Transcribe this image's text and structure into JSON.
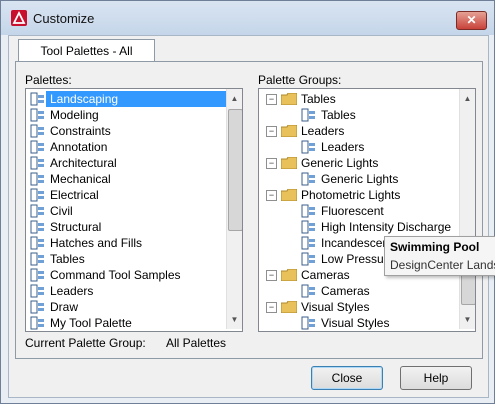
{
  "window": {
    "title": "Customize",
    "close_glyph": "✕",
    "app_icon": "autocad-logo-icon"
  },
  "tab": {
    "label": "Tool Palettes - All Palettes"
  },
  "palettes": {
    "label": "Palettes:",
    "selected_index": 0,
    "items": [
      "Landscaping",
      "Modeling",
      "Constraints",
      "Annotation",
      "Architectural",
      "Mechanical",
      "Electrical",
      "Civil",
      "Structural",
      "Hatches and Fills",
      "Tables",
      "Command Tool Samples",
      "Leaders",
      "Draw",
      "My Tool Palette"
    ]
  },
  "palette_groups": {
    "label": "Palette Groups:",
    "tree": [
      {
        "label": "Tables",
        "level": 0,
        "type": "group"
      },
      {
        "label": "Tables",
        "level": 1,
        "type": "palette"
      },
      {
        "label": "Leaders",
        "level": 0,
        "type": "group"
      },
      {
        "label": "Leaders",
        "level": 1,
        "type": "palette"
      },
      {
        "label": "Generic Lights",
        "level": 0,
        "type": "group"
      },
      {
        "label": "Generic Lights",
        "level": 1,
        "type": "palette"
      },
      {
        "label": "Photometric Lights",
        "level": 0,
        "type": "group"
      },
      {
        "label": "Fluorescent",
        "level": 1,
        "type": "palette"
      },
      {
        "label": "High Intensity Discharge",
        "level": 1,
        "type": "palette"
      },
      {
        "label": "Incandescent",
        "level": 1,
        "type": "palette"
      },
      {
        "label": "Low Pressure Sodium",
        "level": 1,
        "type": "palette"
      },
      {
        "label": "Cameras",
        "level": 0,
        "type": "group"
      },
      {
        "label": "Cameras",
        "level": 1,
        "type": "palette"
      },
      {
        "label": "Visual Styles",
        "level": 0,
        "type": "group"
      },
      {
        "label": "Visual Styles",
        "level": 1,
        "type": "palette"
      }
    ]
  },
  "current_group": {
    "label": "Current Palette Group:",
    "value": "All Palettes"
  },
  "tooltip": {
    "title": "Swimming Pool",
    "subtitle": "DesignCenter Landscaping"
  },
  "buttons": {
    "close": "Close",
    "help": "Help"
  },
  "colors": {
    "selection": "#3399ff",
    "titlebar": "#c5d6ea",
    "close_button": "#c8423a"
  }
}
